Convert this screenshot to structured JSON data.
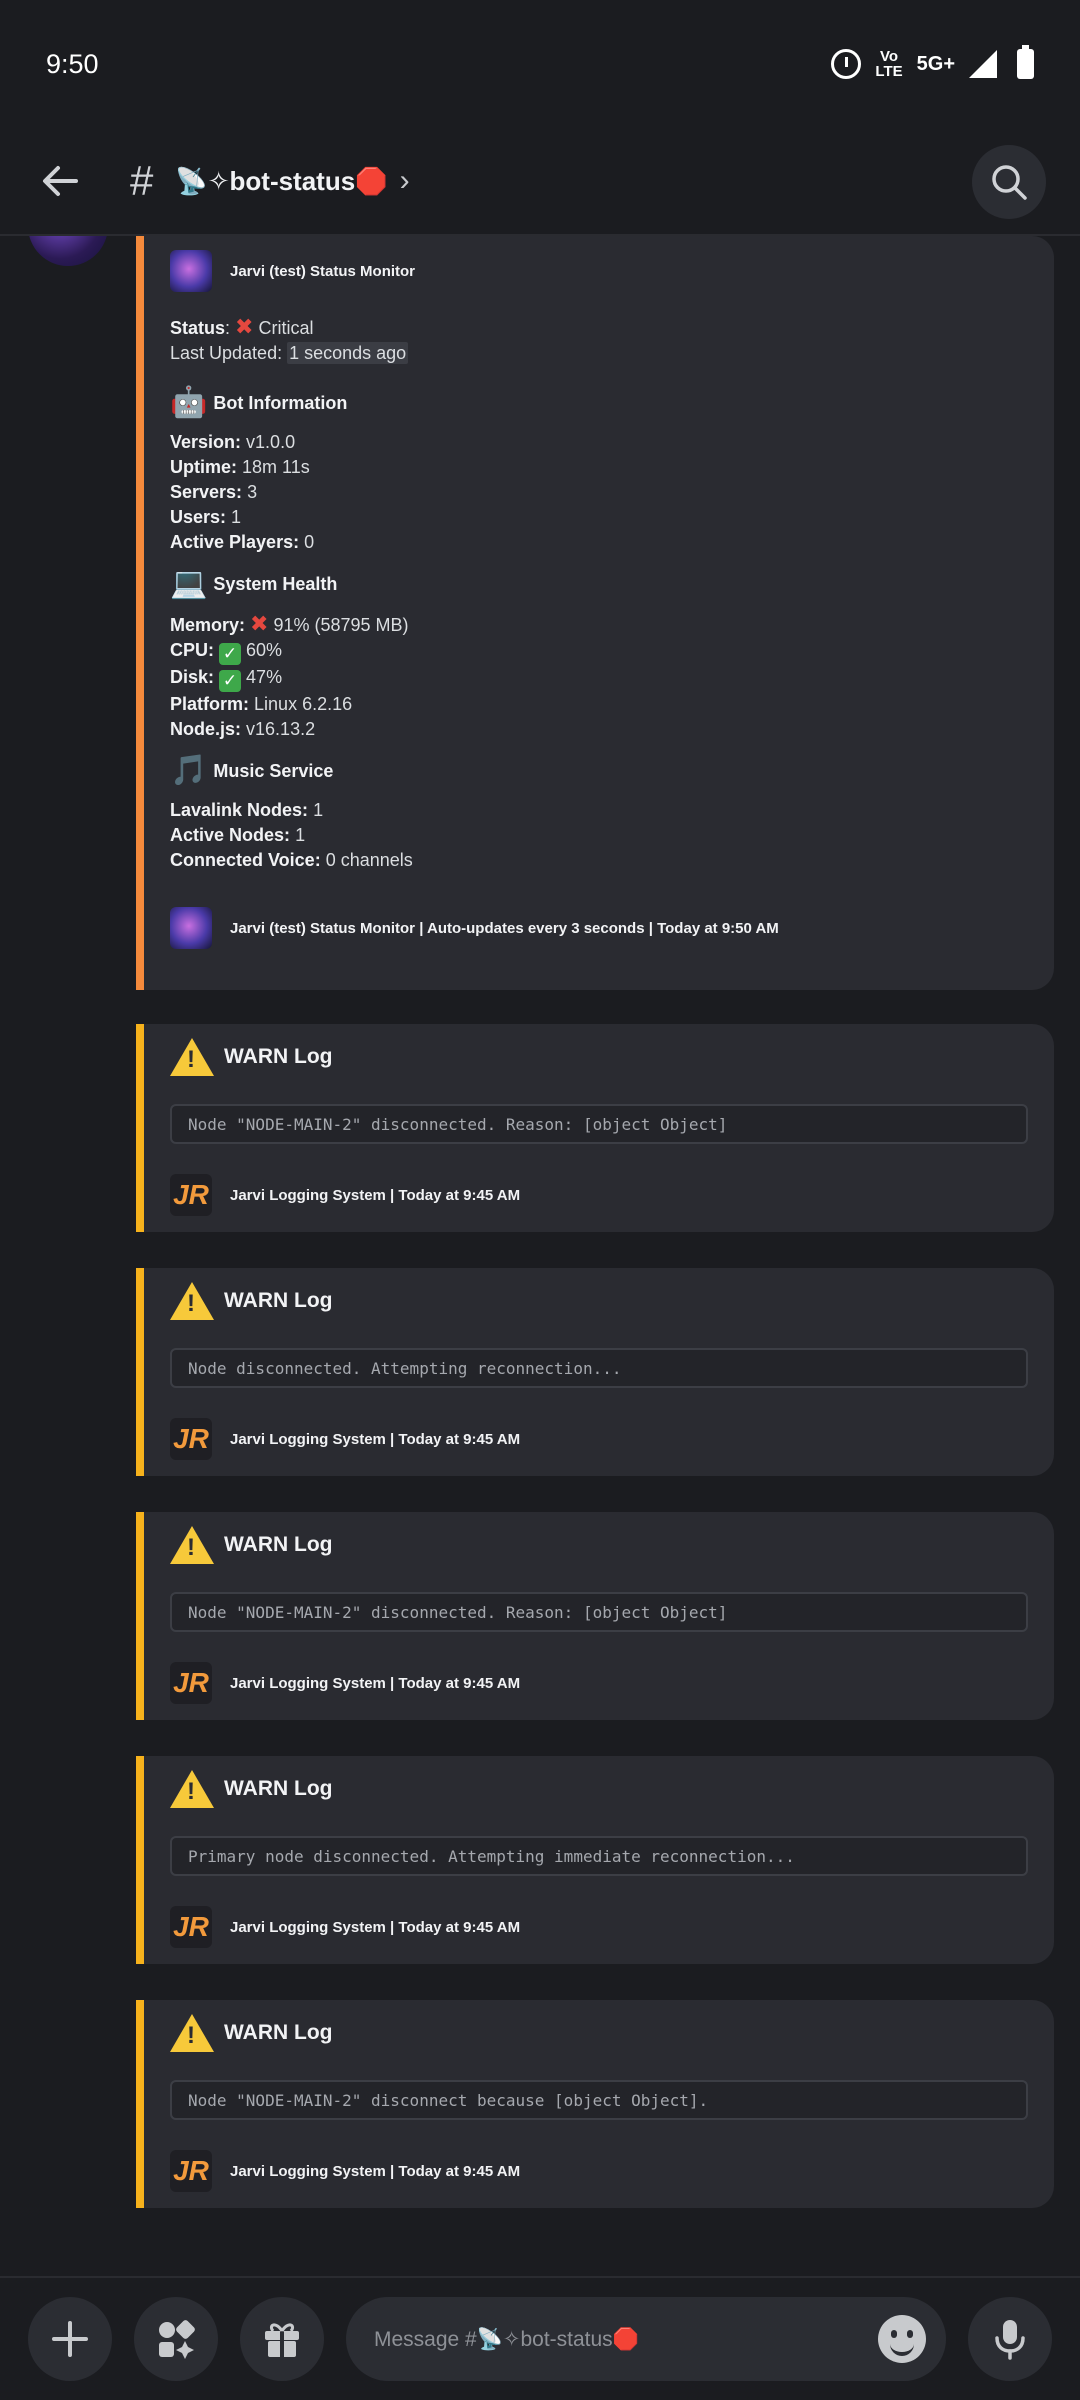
{
  "status_bar": {
    "time": "9:50",
    "volte_top": "Vo",
    "volte_bottom": "LTE",
    "network": "5G+"
  },
  "header": {
    "back_icon": "arrow-left-icon",
    "hash": "#",
    "channel": "📡✧bot-status🛑",
    "chevron": "›",
    "search_icon": "search-icon"
  },
  "status_embed": {
    "author": "Jarvi (test) Status Monitor",
    "status_label": "Status",
    "status_value": "Critical",
    "updated_label": "Last Updated:",
    "updated_value": "1 seconds ago",
    "bot_info": {
      "title": "Bot Information",
      "emoji": "🤖",
      "version_label": "Version:",
      "version": "v1.0.0",
      "uptime_label": "Uptime:",
      "uptime": "18m 11s",
      "servers_label": "Servers:",
      "servers": "3",
      "users_label": "Users:",
      "users": "1",
      "players_label": "Active Players:",
      "players": "0"
    },
    "system_health": {
      "title": "System Health",
      "emoji": "💻",
      "memory_label": "Memory:",
      "memory": "91% (58795 MB)",
      "cpu_label": "CPU:",
      "cpu": "60%",
      "disk_label": "Disk:",
      "disk": "47%",
      "platform_label": "Platform:",
      "platform": "Linux 6.2.16",
      "node_label": "Node.js:",
      "node": "v16.13.2"
    },
    "music": {
      "title": "Music Service",
      "emoji": "🎵",
      "lavalink_label": "Lavalink Nodes:",
      "lavalink": "1",
      "active_label": "Active Nodes:",
      "active": "1",
      "voice_label": "Connected Voice:",
      "voice": "0 channels"
    },
    "footer": "Jarvi (test) Status Monitor | Auto-updates every 3 seconds | Today at 9:50 AM"
  },
  "warn_logs": [
    {
      "title": "WARN Log",
      "message": "Node \"NODE-MAIN-2\" disconnected. Reason: [object Object]",
      "footer": "Jarvi Logging System | Today at 9:45 AM"
    },
    {
      "title": "WARN Log",
      "message": "Node disconnected. Attempting reconnection...",
      "footer": "Jarvi Logging System | Today at 9:45 AM"
    },
    {
      "title": "WARN Log",
      "message": "Node \"NODE-MAIN-2\" disconnected. Reason: [object Object]",
      "footer": "Jarvi Logging System | Today at 9:45 AM"
    },
    {
      "title": "WARN Log",
      "message": "Primary node disconnected. Attempting immediate reconnection...",
      "footer": "Jarvi Logging System | Today at 9:45 AM"
    },
    {
      "title": "WARN Log",
      "message": "Node \"NODE-MAIN-2\" disconnect because [object Object].",
      "footer": "Jarvi Logging System | Today at 9:45 AM"
    }
  ],
  "bottom_bar": {
    "message_placeholder": "Message #📡✧bot-status🛑",
    "plus_icon": "plus-icon",
    "apps_icon": "apps-icon",
    "gift_icon": "gift-icon",
    "emoji_icon": "emoji-icon",
    "mic_icon": "microphone-icon"
  }
}
